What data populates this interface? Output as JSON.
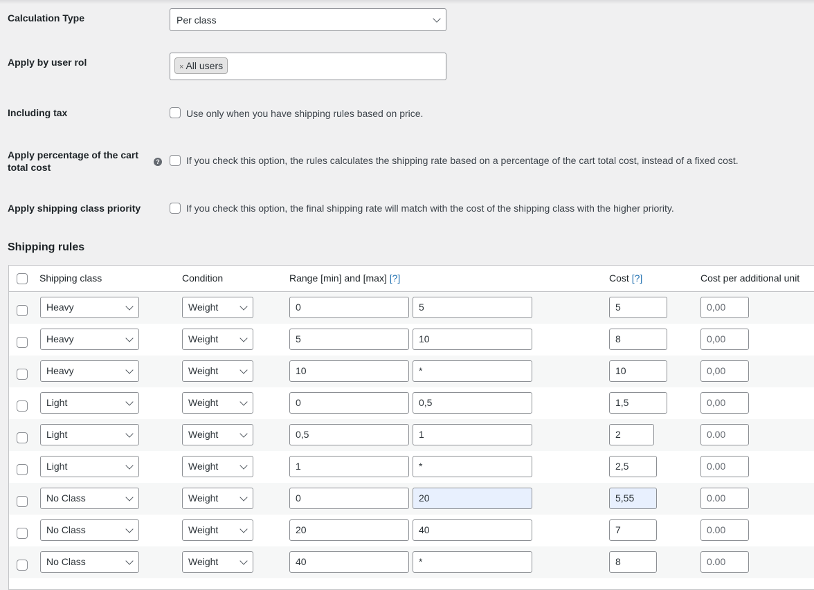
{
  "settings": {
    "calculation_type": {
      "label": "Calculation Type",
      "value": "Per class"
    },
    "user_role": {
      "label": "Apply by user rol",
      "tags": [
        "All users"
      ]
    },
    "including_tax": {
      "label": "Including tax",
      "description": "Use only when you have shipping rules based on price."
    },
    "percentage": {
      "label_line1": "Apply percentage of the cart",
      "label_line2": "total cost",
      "description": "If you check this option, the rules calculates the shipping rate based on a percentage of the cart total cost, instead of a fixed cost."
    },
    "class_priority": {
      "label": "Apply shipping class priority",
      "description": "If you check this option, the final shipping rate will match with the cost of the shipping class with the higher priority."
    }
  },
  "icons": {
    "help": "question-circle-icon",
    "remove_tag": "x-icon",
    "dropdown": "chevron-down-icon"
  },
  "shipping_rules": {
    "title": "Shipping rules",
    "columns": {
      "shipping_class": "Shipping class",
      "condition": "Condition",
      "range": "Range [min] and [max]",
      "range_help": "[?]",
      "cost": "Cost",
      "cost_help": "[?]",
      "cost_per_unit": "Cost per additional unit"
    },
    "rows": [
      {
        "class": "Heavy",
        "condition": "Weight",
        "min": "0",
        "max": "5",
        "cost": "5",
        "extra": "0,00"
      },
      {
        "class": "Heavy",
        "condition": "Weight",
        "min": "5",
        "max": "10",
        "cost": "8",
        "extra": "0,00"
      },
      {
        "class": "Heavy",
        "condition": "Weight",
        "min": "10",
        "max": "*",
        "cost": "10",
        "extra": "0,00"
      },
      {
        "class": "Light",
        "condition": "Weight",
        "min": "0",
        "max": "0,5",
        "cost": "1,5",
        "extra": "0,00"
      },
      {
        "class": "Light",
        "condition": "Weight",
        "min": "0,5",
        "max": "1",
        "cost": "2",
        "extra": "0.00"
      },
      {
        "class": "Light",
        "condition": "Weight",
        "min": "1",
        "max": "*",
        "cost": "2,5",
        "extra": "0.00"
      },
      {
        "class": "No Class",
        "condition": "Weight",
        "min": "0",
        "max": "20",
        "cost": "5,55",
        "extra": "0.00"
      },
      {
        "class": "No Class",
        "condition": "Weight",
        "min": "20",
        "max": "40",
        "cost": "7",
        "extra": "0.00"
      },
      {
        "class": "No Class",
        "condition": "Weight",
        "min": "40",
        "max": "*",
        "cost": "8",
        "extra": "0.00"
      }
    ]
  },
  "colors": {
    "link": "#2271b1",
    "autofill": "#e8f0fe",
    "border": "#8c8f94"
  }
}
